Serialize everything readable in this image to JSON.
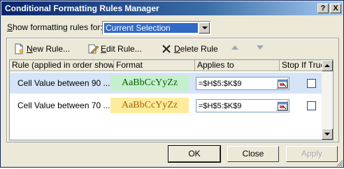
{
  "window": {
    "title": "Conditional Formatting Rules Manager",
    "help_label": "?",
    "close_label": "X"
  },
  "show_rules": {
    "label_prefix": "S",
    "label_rest": "how formatting rules for:",
    "selected": "Current Selection"
  },
  "toolbar": {
    "new_rule_mnemonic": "N",
    "new_rule_rest": "ew Rule...",
    "edit_rule_mnemonic": "E",
    "edit_rule_rest": "dit Rule...",
    "delete_rule_mnemonic": "D",
    "delete_rule_rest": "elete Rule"
  },
  "columns": {
    "rule": "Rule (applied in order shown)",
    "format": "Format",
    "applies_to": "Applies to",
    "stop_if_true": "Stop If True"
  },
  "rules": [
    {
      "rule": "Cell Value between 90 ...",
      "format_preview": "AaBbCcYyZz",
      "applies_to": "=$H$5:$K$9",
      "stop_if_true": false,
      "fill_color": "#c6efce",
      "text_color": "#006100"
    },
    {
      "rule": "Cell Value between 70 ...",
      "format_preview": "AaBbCcYyZz",
      "applies_to": "=$H$5:$K$9",
      "stop_if_true": false,
      "fill_color": "#ffeb9c",
      "text_color": "#9c6500"
    }
  ],
  "buttons": {
    "ok": "OK",
    "close": "Close",
    "apply": "Apply"
  },
  "icons": {
    "new_rule": "new-document-icon",
    "edit_rule": "edit-pencil-icon",
    "delete_rule": "delete-x-icon",
    "move_up": "triangle-up-icon",
    "move_down": "triangle-down-icon",
    "range_picker": "range-select-icon"
  },
  "colors": {
    "title_bar": "#0a246a",
    "selection": "#316ac5",
    "selected_row": "#d6e4f7"
  }
}
